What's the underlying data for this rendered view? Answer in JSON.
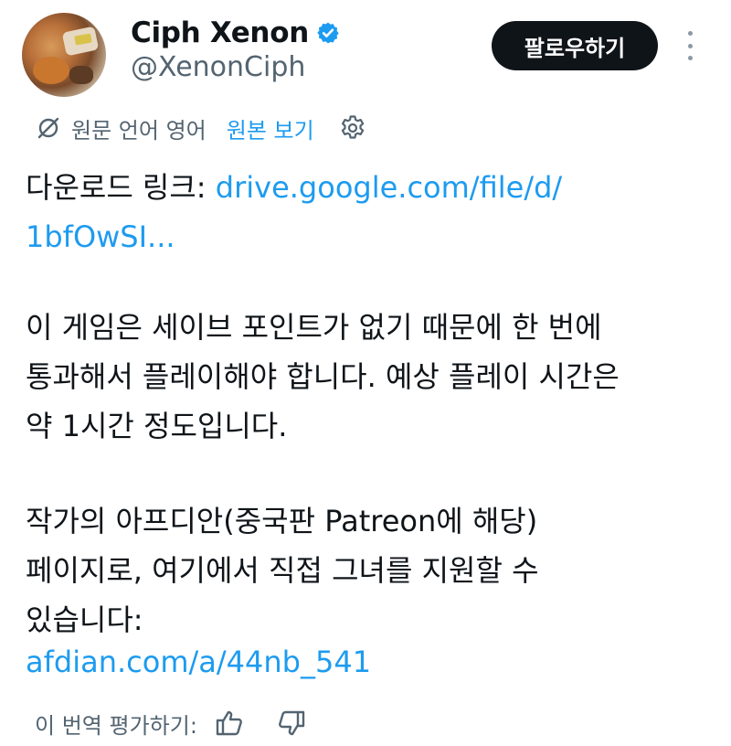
{
  "author": {
    "display_name": "Ciph Xenon",
    "handle": "@XenonCiph",
    "verified": true
  },
  "follow_button": {
    "label": "팔로우하기"
  },
  "translation_bar": {
    "notice": "원문 언어 영어",
    "show_original": "원본 보기"
  },
  "post": {
    "line1_text": "다운로드 링크: ",
    "line1_link": "drive.google.com/file/d/",
    "line2_link": "1bfOwSI...",
    "para2_line1": "이 게임은 세이브 포인트가 없기 때문에 한 번에",
    "para2_line2": "통과해서 플레이해야 합니다. 예상 플레이 시간은",
    "para2_line3": "약 1시간 정도입니다.",
    "para3_line1": "작가의 아프디안(중국판 Patreon에 해당)",
    "para3_line2": "페이지로, 여기에서 직접 그녀를 지원할 수",
    "para3_line3": "있습니다:",
    "link2": "afdian.com/a/44nb_541"
  },
  "rating": {
    "label": "이 번역 평가하기:"
  },
  "icons": {
    "verified": "verified-badge-icon",
    "more": "more-vertical-icon",
    "translate": "translate-off-icon",
    "settings": "gear-icon",
    "thumb_up": "thumbs-up-icon",
    "thumb_down": "thumbs-down-icon"
  },
  "colors": {
    "link": "#1d9bf0",
    "text": "#0f1419",
    "secondary": "#536471",
    "button_bg": "#0f1419"
  }
}
